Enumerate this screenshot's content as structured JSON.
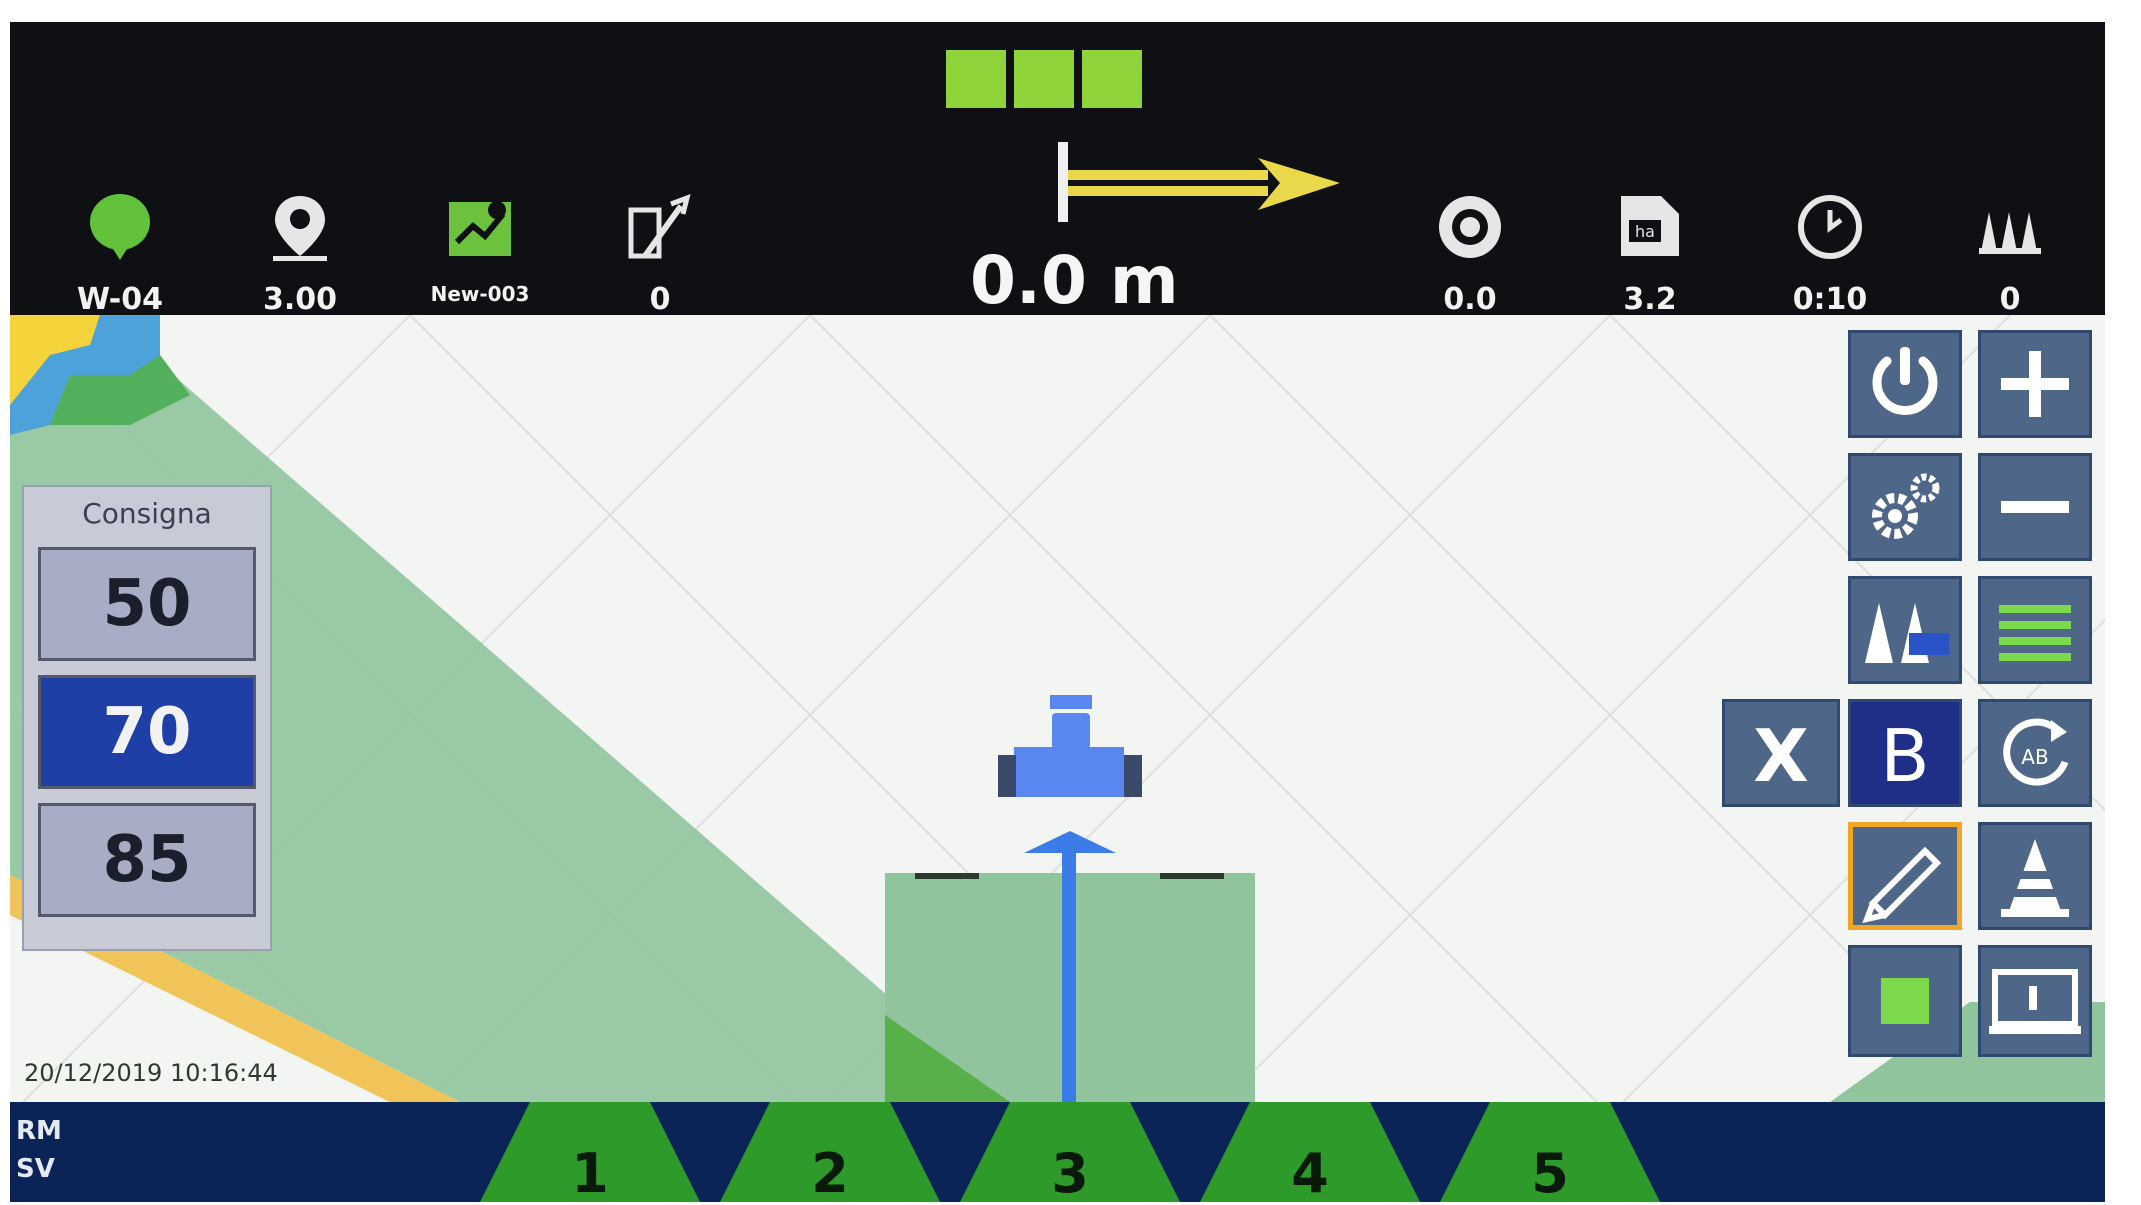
{
  "topbar": {
    "status_squares": [
      "green",
      "green",
      "green"
    ],
    "left_stats": [
      {
        "icon": "gnss-signal-icon",
        "value": "W-04"
      },
      {
        "icon": "location-pin-icon",
        "value": "3.00"
      },
      {
        "icon": "field-map-icon",
        "value": "New-003"
      },
      {
        "icon": "guidance-lines-icon",
        "value": "0"
      }
    ],
    "distance": "0.0 m",
    "right_stats": [
      {
        "icon": "speed-wheel-icon",
        "value": "0.0"
      },
      {
        "icon": "area-ha-icon",
        "value": "3.2",
        "badge": "ha"
      },
      {
        "icon": "clock-icon",
        "value": "0:10"
      },
      {
        "icon": "sections-icon",
        "value": "0"
      }
    ]
  },
  "consigna": {
    "title": "Consigna",
    "values": [
      "50",
      "70",
      "85"
    ],
    "selected": "70"
  },
  "datetime": "20/12/2019 10:16:44",
  "side_buttons": {
    "x_label": "X",
    "b_label": "B",
    "ab_label": "AB"
  },
  "bottom": {
    "label1": "RM",
    "label2": "SV",
    "sections": [
      "1",
      "2",
      "3",
      "4",
      "5"
    ]
  },
  "colors": {
    "accent_green": "#8fd43a",
    "section_green": "#2e9a2a",
    "bottom_navy": "#0b2457",
    "button_slate": "#4e6687",
    "highlight_orange": "#f0a626",
    "tractor_blue": "#5a86f0"
  }
}
